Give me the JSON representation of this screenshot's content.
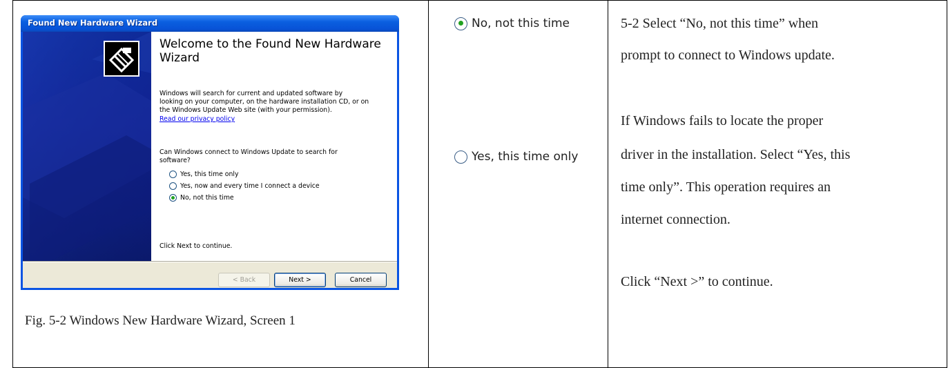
{
  "wizard": {
    "title_bar": "Found New Hardware Wizard",
    "heading": "Welcome to the Found New Hardware Wizard",
    "intro_lines": [
      "Windows will search for current and updated software by",
      "looking on your computer, on the hardware installation CD, or on",
      "the Windows Update Web site (with your permission)."
    ],
    "privacy_link": "Read our privacy policy",
    "question_lines": [
      "Can Windows connect to Windows Update to search for",
      "software?"
    ],
    "options": [
      {
        "label": "Yes, this time only",
        "selected": false
      },
      {
        "label": "Yes, now and every time I connect a device",
        "selected": false
      },
      {
        "label": "No, not this time",
        "selected": true
      }
    ],
    "footer_text": "Click Next to continue.",
    "buttons": {
      "back": "< Back",
      "next": "Next >",
      "cancel": "Cancel"
    }
  },
  "caption": "Fig. 5-2 Windows New Hardware Wizard, Screen 1",
  "middle": {
    "radio_no": {
      "label": "No, not this time",
      "selected": true
    },
    "radio_yes": {
      "label": "Yes, this time only",
      "selected": false
    }
  },
  "instructions": {
    "lines": [
      "5-2 Select “No, not this time” when",
      "prompt to connect to Windows update.",
      "If Windows fails to locate the proper",
      "driver in the installation. Select “Yes, this",
      "time only”. This operation requires an",
      "internet connection.",
      "Click “Next >” to continue."
    ]
  },
  "colors": {
    "titlebar": "#0a5fe0",
    "side_panel": "#12229a",
    "selected_dot": "#21a121",
    "link": "#0000ee"
  }
}
